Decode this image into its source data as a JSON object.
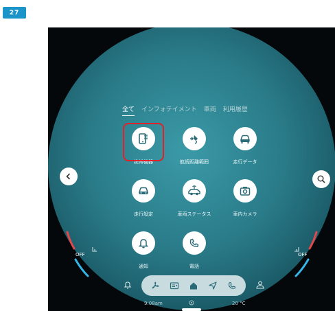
{
  "page_number": "27",
  "tabs": [
    {
      "label": "全て",
      "active": true
    },
    {
      "label": "インフォテイメント",
      "active": false
    },
    {
      "label": "車両",
      "active": false
    },
    {
      "label": "利用履歴",
      "active": false
    }
  ],
  "apps": [
    {
      "label": "携帯機器",
      "icon": "phone-device-icon"
    },
    {
      "label": "航続距離範囲",
      "icon": "ev-charge-range-icon"
    },
    {
      "label": "走行データ",
      "icon": "car-driving-data-icon"
    },
    {
      "label": "走行設定",
      "icon": "car-settings-icon"
    },
    {
      "label": "車両ステータス",
      "icon": "vehicle-status-icon"
    },
    {
      "label": "車内カメラ",
      "icon": "camera-icon"
    },
    {
      "label": "通知",
      "icon": "bell-icon"
    },
    {
      "label": "電話",
      "icon": "phone-handset-icon"
    }
  ],
  "climate": {
    "left_label": "OFF",
    "right_label": "OFF"
  },
  "status_bar": {
    "time": "9:08am",
    "temperature": "20 °C"
  },
  "colors": {
    "highlight": "#e0222b",
    "badge": "#1a94c9",
    "heat": "#e2474c",
    "cool": "#36b6e6"
  }
}
